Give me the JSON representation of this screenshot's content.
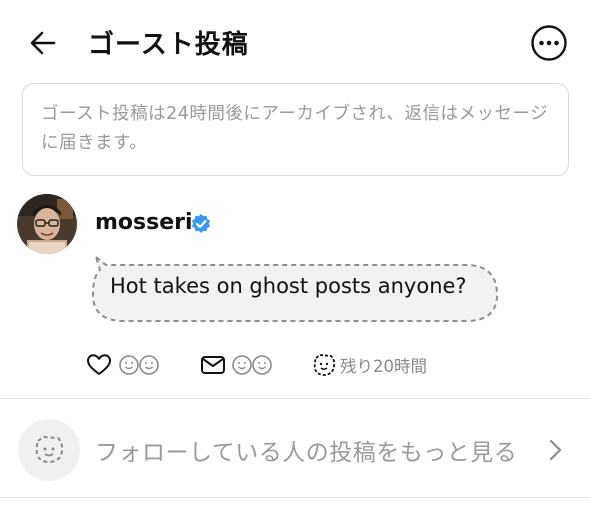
{
  "header": {
    "title": "ゴースト投稿"
  },
  "notice": {
    "text": "ゴースト投稿は24時間後にアーカイブされ、返信はメッセージに届きます。"
  },
  "post": {
    "username": "mosseri",
    "verified": true,
    "text": "Hot takes on ghost posts anyone?",
    "time_remaining": "残り20時間"
  },
  "see_more": {
    "label": "フォローしている人の投稿をもっと見る"
  },
  "colors": {
    "verified_blue": "#3897f0",
    "muted_text": "#9a9a9a",
    "bubble_fill": "#f2f2f2",
    "bubble_border": "#8e8e8e"
  }
}
